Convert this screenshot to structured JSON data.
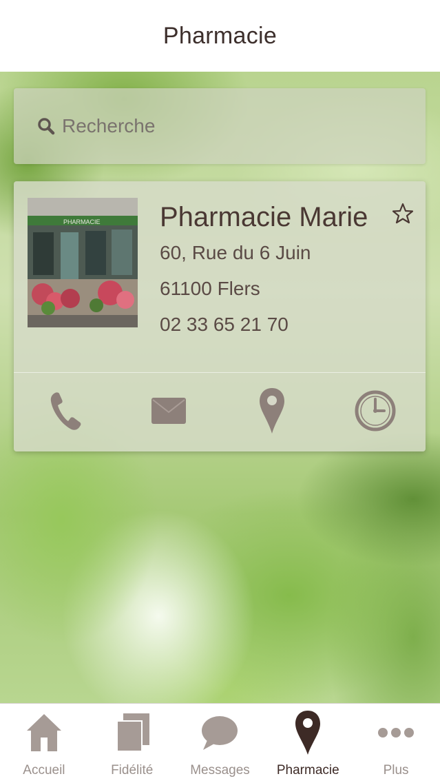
{
  "header": {
    "title": "Pharmacie"
  },
  "search": {
    "placeholder": "Recherche"
  },
  "pharmacy": {
    "name": "Pharmacie Marie",
    "address_line1": "60, Rue du 6 Juin",
    "address_line2": "61100 Flers",
    "phone": "02 33 65 21 70",
    "photo_sign_text": "PHARMACIE",
    "actions": [
      "phone-icon",
      "mail-icon",
      "map-pin-icon",
      "clock-icon"
    ]
  },
  "tabs": [
    {
      "label": "Accueil",
      "icon": "home-icon",
      "active": false
    },
    {
      "label": "Fidélité",
      "icon": "cards-icon",
      "active": false
    },
    {
      "label": "Messages",
      "icon": "chat-bubble-icon",
      "active": false
    },
    {
      "label": "Pharmacie",
      "icon": "map-pin-icon",
      "active": true
    },
    {
      "label": "Plus",
      "icon": "more-dots-icon",
      "active": false
    }
  ],
  "colors": {
    "accent_dark": "#3d2a26",
    "icon_muted": "#a69b96",
    "card_icon": "#8d807a"
  }
}
